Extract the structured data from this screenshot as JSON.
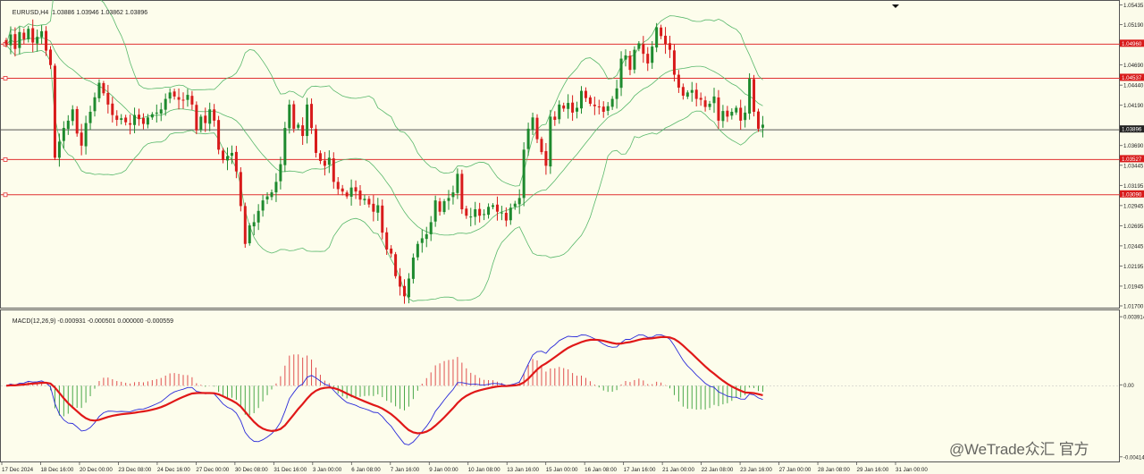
{
  "chart_header": {
    "symbol_label": "EURUSD,H4",
    "ohlc_text": "1.03886 1.03946 1.03862 1.03896"
  },
  "indicator_header": {
    "label": "MACD(12,26,9)",
    "values_text": "-0.000931 -0.000501 0.000000 -0.000559"
  },
  "watermark": "@WeTrade众汇 官方",
  "colors": {
    "background": "#fdfdec",
    "bull_candle": "#1e8a2e",
    "bear_candle": "#d81b1b",
    "bollinger": "#58b86b",
    "hline": "#e03030",
    "current_price_line": "#555555",
    "macd_line": "#2b2bd9",
    "signal_line": "#e01818",
    "hist_pos": "#e05050",
    "hist_neg": "#4aa84a",
    "price_box": "#d81b1b"
  },
  "chart_data": [
    {
      "type": "candlestick",
      "symbol": "EURUSD",
      "timeframe": "H4",
      "ylim": [
        1.017,
        1.0543
      ],
      "y_tick_labels": [
        "1.05435",
        "1.05190",
        "1.04690",
        "1.04440",
        "1.04190",
        "1.03690",
        "1.03445",
        "1.03195",
        "1.02945",
        "1.02695",
        "1.02445",
        "1.02195",
        "1.01945",
        "1.01700"
      ],
      "hlines": [
        {
          "value": 1.0496,
          "label": "1.04960"
        },
        {
          "value": 1.04537,
          "label": "1.04537"
        },
        {
          "value": 1.03527,
          "label": "1.03527"
        },
        {
          "value": 1.0309,
          "label": "1.03090"
        }
      ],
      "current_price": {
        "value": 1.03896,
        "label": "1.03896"
      },
      "x_tick_labels": [
        "17 Dec 2024",
        "18 Dec 16:00",
        "20 Dec 00:00",
        "23 Dec 08:00",
        "24 Dec 16:00",
        "27 Dec 00:00",
        "30 Dec 08:00",
        "31 Dec 16:00",
        "3 Jan 00:00",
        "6 Jan 08:00",
        "7 Jan 16:00",
        "9 Jan 00:00",
        "10 Jan 08:00",
        "13 Jan 16:00",
        "15 Jan 00:00",
        "16 Jan 08:00",
        "17 Jan 16:00",
        "21 Jan 00:00",
        "22 Jan 08:00",
        "23 Jan 16:00",
        "27 Jan 00:00",
        "28 Jan 08:00",
        "29 Jan 16:00",
        "31 Jan 00:00"
      ],
      "close_path": [
        1.0495,
        1.0508,
        1.049,
        1.0511,
        1.0502,
        1.0515,
        1.0498,
        1.0505,
        1.0512,
        1.0488,
        1.047,
        1.0355,
        1.0375,
        1.0392,
        1.0401,
        1.0415,
        1.0385,
        1.037,
        1.0398,
        1.0412,
        1.043,
        1.0448,
        1.0435,
        1.0421,
        1.0408,
        1.0402,
        1.0404,
        1.0399,
        1.0396,
        1.0408,
        1.0403,
        1.0397,
        1.0405,
        1.0409,
        1.0411,
        1.0415,
        1.0428,
        1.0436,
        1.0431,
        1.0427,
        1.0426,
        1.0433,
        1.0421,
        1.0389,
        1.0406,
        1.0398,
        1.0415,
        1.0401,
        1.0365,
        1.0352,
        1.0357,
        1.0361,
        1.0338,
        1.0295,
        1.0248,
        1.0271,
        1.0275,
        1.0289,
        1.0302,
        1.0307,
        1.0312,
        1.0325,
        1.0347,
        1.0392,
        1.0421,
        1.0391,
        1.0396,
        1.0382,
        1.0421,
        1.0392,
        1.0361,
        1.0351,
        1.0345,
        1.0355,
        1.0325,
        1.0316,
        1.0313,
        1.0307,
        1.0318,
        1.0313,
        1.0303,
        1.0304,
        1.0297,
        1.0288,
        1.0296,
        1.0262,
        1.0241,
        1.0236,
        1.0208,
        1.0195,
        1.0183,
        1.0205,
        1.0231,
        1.0248,
        1.0255,
        1.026,
        1.0275,
        1.0302,
        1.0288,
        1.0301,
        1.0305,
        1.0312,
        1.0335,
        1.0291,
        1.0283,
        1.0282,
        1.0291,
        1.0283,
        1.0285,
        1.0294,
        1.0296,
        1.0288,
        1.0287,
        1.0277,
        1.0293,
        1.0298,
        1.0305,
        1.0365,
        1.0391,
        1.0405,
        1.0378,
        1.0362,
        1.0345,
        1.0406,
        1.0402,
        1.0421,
        1.0416,
        1.0423,
        1.0411,
        1.0417,
        1.0438,
        1.0429,
        1.0422,
        1.0419,
        1.0418,
        1.0412,
        1.0419,
        1.0428,
        1.0441,
        1.0478,
        1.0482,
        1.0464,
        1.0489,
        1.0497,
        1.0484,
        1.0472,
        1.0493,
        1.0517,
        1.0506,
        1.0496,
        1.0489,
        1.0458,
        1.0442,
        1.0432,
        1.0436,
        1.0439,
        1.0428,
        1.0427,
        1.0418,
        1.0422,
        1.0431,
        1.0401,
        1.0413,
        1.0406,
        1.0412,
        1.0417,
        1.0401,
        1.0411,
        1.0453,
        1.0412,
        1.0391,
        1.0396
      ],
      "macd_ylim": [
        -0.0042,
        0.00392
      ],
      "macd_y_tick_labels": [
        "0.003914",
        "0.00",
        "-0.00414"
      ]
    }
  ]
}
